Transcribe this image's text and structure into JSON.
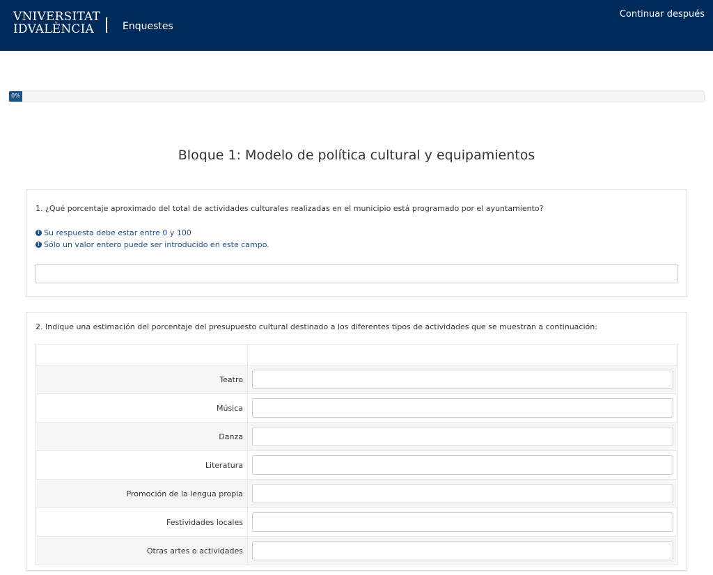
{
  "header": {
    "logo_line1": "VNIVERSITAT",
    "logo_line2": "IDVALÈNCIA",
    "app_name": "Enquestes",
    "continue_later": "Continuar después"
  },
  "progress": {
    "label": "0%",
    "value": 0
  },
  "block_title": "Bloque 1: Modelo de política cultural y equipamientos",
  "question1": {
    "text": "1. ¿Qué porcentaje aproximado del total de actividades culturales realizadas en el municipio está programado por el ayuntamiento?",
    "tips": [
      "Su respuesta debe estar entre 0 y 100",
      "Sólo un valor entero puede ser introducido en este campo."
    ],
    "value": ""
  },
  "question2": {
    "text": "2. Indique una estimación del porcentaje del presupuesto cultural destinado a los diferentes tipos de actividades que se muestran a continuación:",
    "rows": [
      "Teatro",
      "Música",
      "Danza",
      "Literatura",
      "Promoción de la lengua propia",
      "Festividades locales",
      "Otras artes o actividades"
    ]
  },
  "colors": {
    "header_bg": "#002a59",
    "accent": "#1e4f86",
    "row_stripe": "#f7f7f7"
  },
  "icons": {
    "tip": "info-circle-icon"
  }
}
